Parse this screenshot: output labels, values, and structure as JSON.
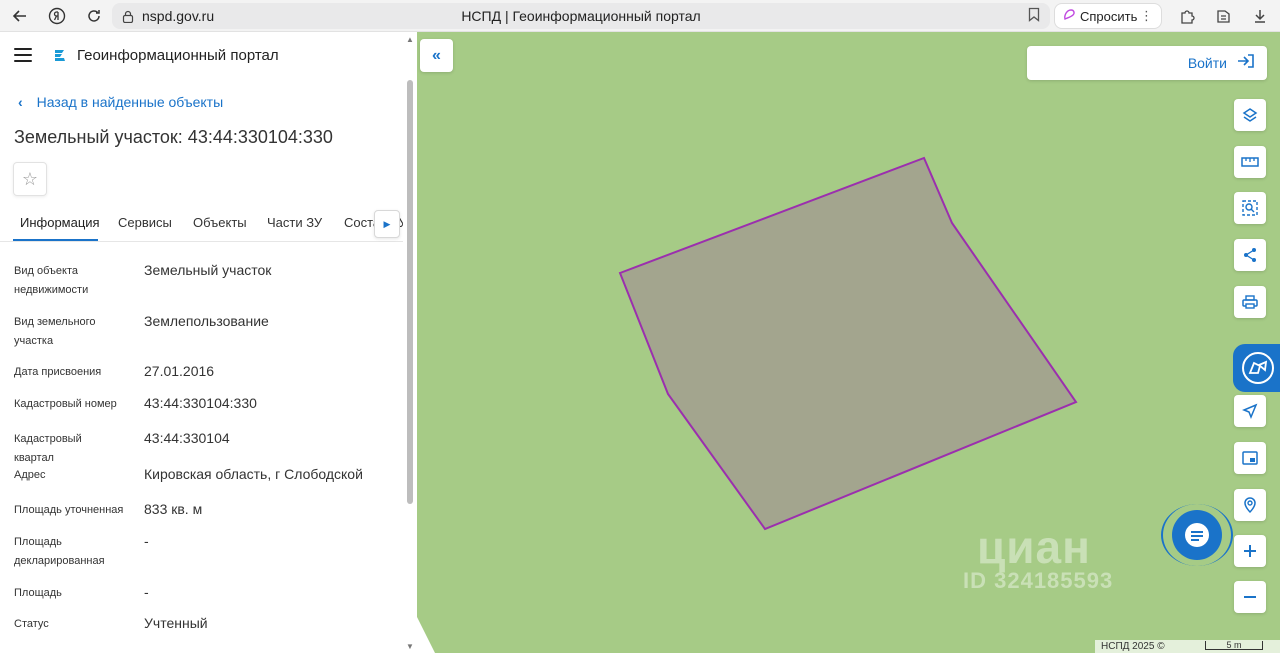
{
  "browser": {
    "url": "nspd.gov.ru",
    "tab_title": "НСПД | Геоинформационный портал",
    "ask_label": "Спросить"
  },
  "sidebar": {
    "portal_name": "Геоинформационный портал",
    "back_label": "Назад в найденные объекты",
    "object_title": "Земельный участок: 43:44:330104:330",
    "tabs": [
      "Информация",
      "Сервисы",
      "Объекты",
      "Части ЗУ",
      "Состав ЗУ"
    ],
    "properties": [
      {
        "label": "Вид объекта недвижимости",
        "value": "Земельный участок"
      },
      {
        "label": "Вид земельного участка",
        "value": "Землепользование"
      },
      {
        "label": "Дата присвоения",
        "value": "27.01.2016"
      },
      {
        "label": "Кадастровый номер",
        "value": "43:44:330104:330"
      },
      {
        "label": "Кадастровый квартал",
        "value": "43:44:330104"
      },
      {
        "label": "Адрес",
        "value": "Кировская область, г Слободской"
      },
      {
        "label": "Площадь уточненная",
        "value": "833 кв. м"
      },
      {
        "label": "Площадь декларированная",
        "value": "-"
      },
      {
        "label": "Площадь",
        "value": "-"
      },
      {
        "label": "Статус",
        "value": "Учтенный"
      }
    ]
  },
  "map": {
    "login_label": "Войти",
    "watermark_brand": "циан",
    "watermark_id": "ID 324185593",
    "footer_text": "НСПД 2025 ©",
    "scale_label": "5 m",
    "background_color": "#a6cb86",
    "parcel_fill": "#a3a58e",
    "parcel_stroke": "#9b2fae",
    "accent_color": "#1a73c9"
  }
}
